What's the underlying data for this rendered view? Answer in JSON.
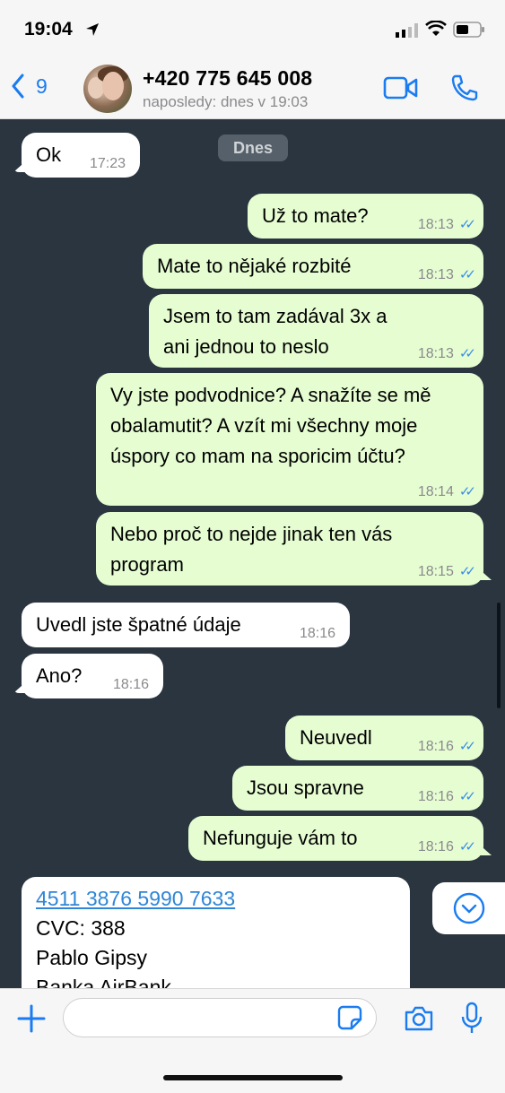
{
  "status": {
    "time": "19:04"
  },
  "header": {
    "back_count": "9",
    "contact": "+420 775 645 008",
    "presence": "naposledy: dnes v 19:03"
  },
  "chat": {
    "date_separator": "Dnes",
    "messages": [
      {
        "dir": "in",
        "text": "Ok",
        "time": "17:23"
      },
      {
        "dir": "out",
        "text": "Už to mate?",
        "time": "18:13"
      },
      {
        "dir": "out",
        "text": "Mate to nějaké rozbité",
        "time": "18:13"
      },
      {
        "dir": "out",
        "text": "Jsem to tam zadával 3x a ani jednou to neslo",
        "time": "18:13"
      },
      {
        "dir": "out",
        "text": "Vy jste podvodnice? A snažíte se mě obalamutit? A vzít mi všechny moje úspory co mam na sporicim účtu?",
        "time": "18:14"
      },
      {
        "dir": "out",
        "text": "Nebo proč to nejde jinak ten vás program",
        "time": "18:15"
      },
      {
        "dir": "in",
        "text": "Uvedl jste špatné údaje",
        "time": "18:16"
      },
      {
        "dir": "in",
        "text": "Ano?",
        "time": "18:16"
      },
      {
        "dir": "out",
        "text": "Neuvedl",
        "time": "18:16"
      },
      {
        "dir": "out",
        "text": "Jsou spravne",
        "time": "18:16"
      },
      {
        "dir": "out",
        "text": "Nefunguje vám to",
        "time": "18:16"
      }
    ],
    "card": {
      "card_number": "4511 3876 5990 7633",
      "cvc": "CVC: 388",
      "name": "Pablo Gipsy",
      "bank": "Banka AirBank"
    }
  },
  "composer": {
    "placeholder": ""
  },
  "colors": {
    "accent": "#1a7cf0",
    "chat_bg": "#2a3540",
    "outgoing": "#e6fdd2",
    "incoming": "#ffffff",
    "ticks": "#3a8ee6"
  },
  "icons": [
    "location-arrow-icon",
    "signal-icon",
    "wifi-icon",
    "battery-icon",
    "back-chevron-icon",
    "video-call-icon",
    "phone-icon",
    "chevron-down-icon",
    "plus-icon",
    "sticker-icon",
    "camera-icon",
    "microphone-icon"
  ]
}
